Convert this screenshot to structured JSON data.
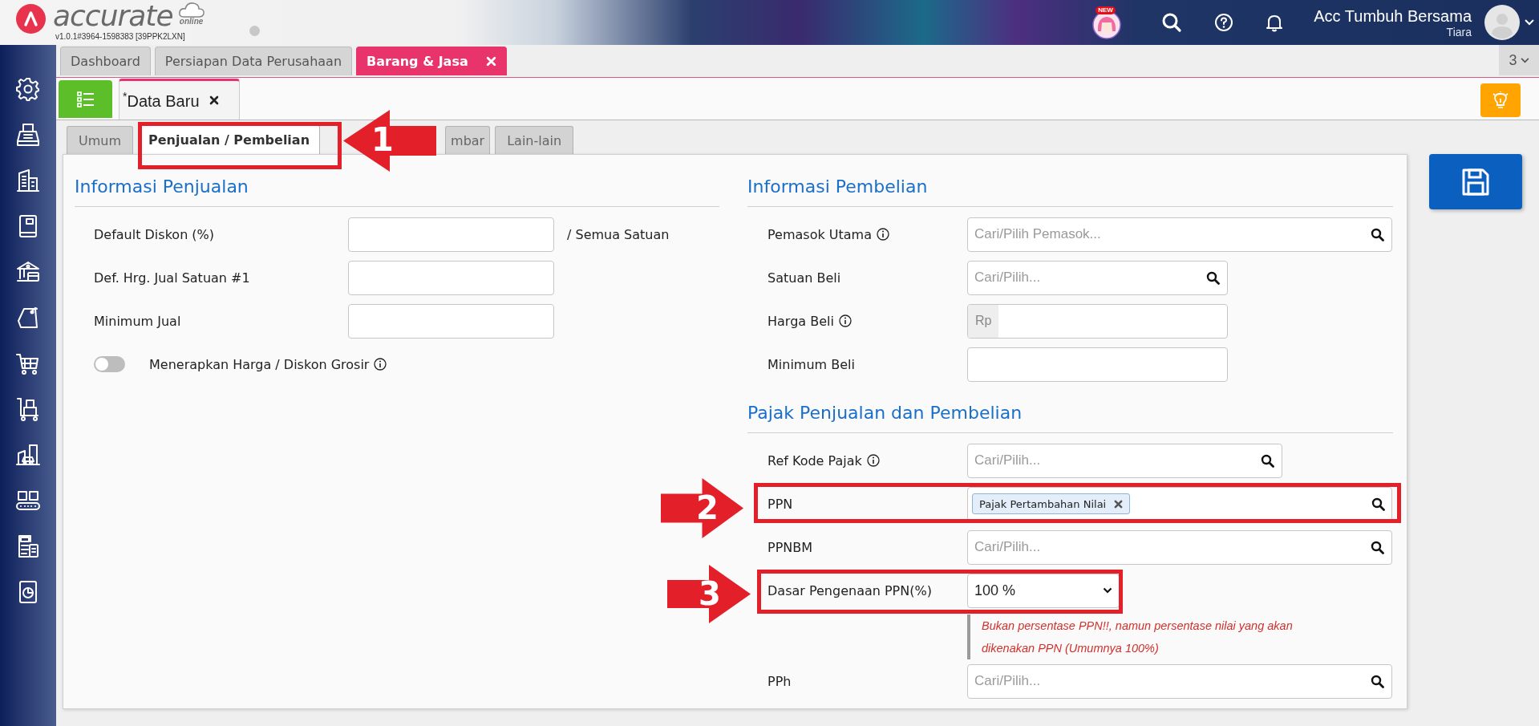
{
  "header": {
    "logo_text": "accurate",
    "logo_subtext": "online",
    "version": "v1.0.1#3964-1598383 [39PPK2LXN]",
    "new_badge": "NEW",
    "company": "Acc Tumbuh Bersama",
    "user": "Tiara"
  },
  "page_tabs": [
    {
      "label": "Dashboard",
      "selected": false,
      "closable": false
    },
    {
      "label": "Persiapan Data Perusahaan",
      "selected": false,
      "closable": false
    },
    {
      "label": "Barang & Jasa",
      "selected": true,
      "closable": true
    }
  ],
  "tab_count": "3",
  "doc_tabs": [
    {
      "label": "$^{*}$Data Baru",
      "selected": true,
      "closable": true
    }
  ],
  "form_tabs": [
    {
      "label": "Umum",
      "selected": false
    },
    {
      "label": "Penjualan / Pembelian",
      "selected": true
    },
    {
      "label": "mbar",
      "selected": false
    },
    {
      "label": "Lain-lain",
      "selected": false
    }
  ],
  "sales": {
    "title": "Informasi Penjualan",
    "fields": [
      {
        "kind": "text",
        "label": "Default Diskon (%)",
        "info": false,
        "suffix": "/ Semua Satuan"
      },
      {
        "kind": "text",
        "label": "Def. Hrg. Jual Satuan #1",
        "info": false
      },
      {
        "kind": "text",
        "label": "Minimum Jual",
        "info": false
      },
      {
        "kind": "toggle",
        "label": "Menerapkan Harga / Diskon Grosir",
        "info": true,
        "on": false
      }
    ]
  },
  "purchase": {
    "title": "Informasi Pembelian",
    "fields": [
      {
        "kind": "search",
        "label": "Pemasok Utama",
        "info": true,
        "placeholder": "Cari/Pilih Pemasok..."
      },
      {
        "kind": "search",
        "label": "Satuan Beli",
        "info": false,
        "placeholder": "Cari/Pilih..."
      },
      {
        "kind": "currency",
        "label": "Harga Beli",
        "info": true,
        "prefix": "Rp"
      },
      {
        "kind": "text",
        "label": "Minimum Beli",
        "info": false
      }
    ]
  },
  "tax": {
    "title": "Pajak Penjualan dan Pembelian",
    "fields": [
      {
        "kind": "search",
        "label": "Ref Kode Pajak",
        "info": true,
        "placeholder": "Cari/Pilih..."
      },
      {
        "kind": "tags",
        "label": "PPN",
        "info": false,
        "tags": [
          "Pajak Pertambahan Nilai"
        ]
      },
      {
        "kind": "search",
        "label": "PPNBM",
        "info": false,
        "placeholder": "Cari/Pilih..."
      },
      {
        "kind": "select",
        "label": "Dasar Pengenaan PPN(%)",
        "info": false,
        "value": "100 %",
        "note": "Bukan persentase PPN!!, namun persentase nilai yang akan dikenakan PPN (Umumnya 100%)"
      },
      {
        "kind": "search",
        "label": "PPh",
        "info": false,
        "placeholder": "Cari/Pilih..."
      }
    ]
  },
  "annotations": [
    {
      "label": "1"
    },
    {
      "label": "2"
    },
    {
      "label": "3"
    }
  ]
}
